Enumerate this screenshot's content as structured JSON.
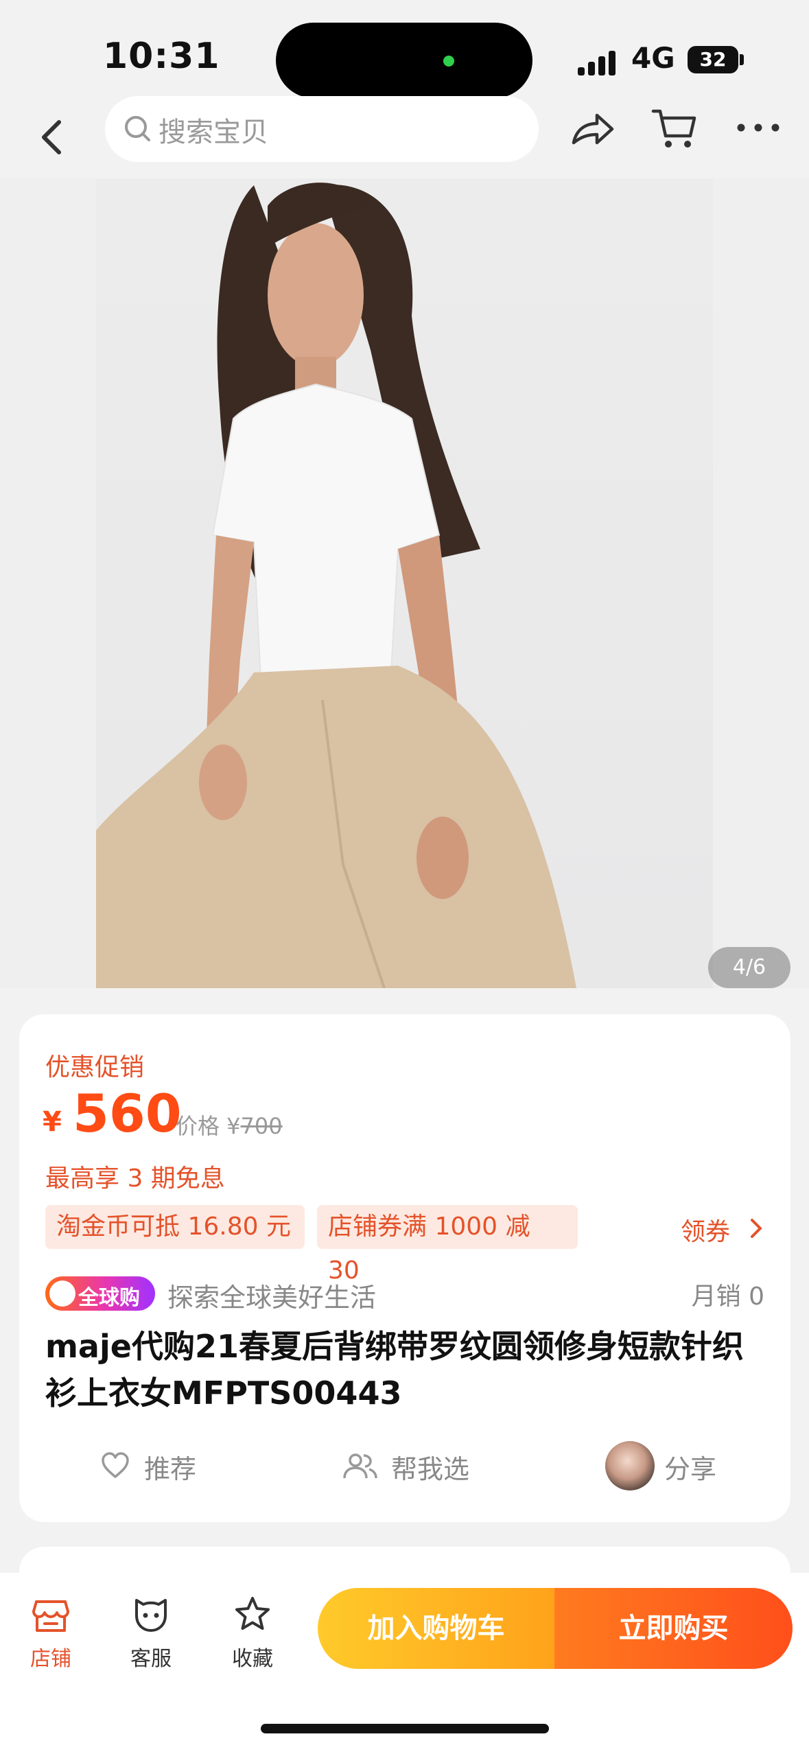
{
  "status_bar": {
    "time": "10:31",
    "network": "4G",
    "battery": "32"
  },
  "nav": {
    "search_placeholder": "搜索宝贝",
    "icons": [
      "back-icon",
      "search-icon",
      "share-icon",
      "cart-icon",
      "more-icon"
    ]
  },
  "gallery": {
    "counter": "4/6"
  },
  "product": {
    "promo_label": "优惠促销",
    "currency": "¥",
    "price": "560",
    "orig_price_label": "价格 ¥",
    "orig_price": "700",
    "installment": "最高享 3 期免息",
    "tags": [
      "淘金币可抵 16.80 元",
      "店铺券满 1000 减 30"
    ],
    "coupon_label": "领券",
    "global_badge": "全球购",
    "slogan": "探索全球美好生活",
    "sales": "月销  0",
    "title": "maje代购21春夏后背绑带罗纹圆领修身短款针织衫上衣女MFPTS00443",
    "actions": {
      "recommend": "推荐",
      "help_choose": "帮我选",
      "share": "分享"
    }
  },
  "bottom_bar": {
    "tabs": [
      {
        "label": "店铺",
        "icon": "store-icon"
      },
      {
        "label": "客服",
        "icon": "service-icon"
      },
      {
        "label": "收藏",
        "icon": "star-icon"
      }
    ],
    "add_to_cart": "加入购物车",
    "buy_now": "立即购买"
  },
  "colors": {
    "accent": "#ff4b14",
    "accent_text": "#e4522a",
    "tag_bg": "#fde9e1",
    "cart_button": "#ffb41f",
    "buy_button": "#ff5a1b"
  }
}
